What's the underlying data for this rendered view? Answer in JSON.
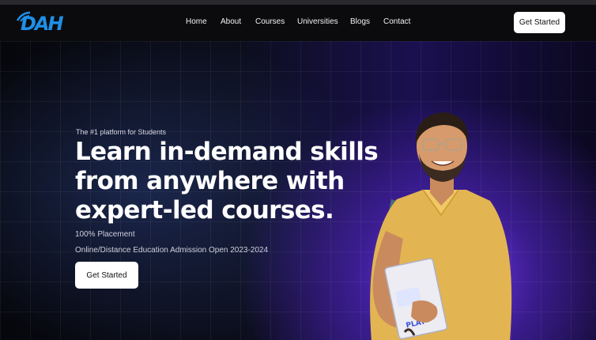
{
  "brand": {
    "logo_text": "DAH",
    "logo_color": "#1f8fe8"
  },
  "nav": {
    "items": [
      {
        "label": "Home"
      },
      {
        "label": "About"
      },
      {
        "label": "Courses"
      },
      {
        "label": "Universities"
      },
      {
        "label": "Blogs"
      },
      {
        "label": "Contact"
      }
    ],
    "cta_label": "Get Started"
  },
  "hero": {
    "tagline": "The #1 platform for Students",
    "headline_lines": [
      "Learn in-demand skills",
      "from anywhere with",
      "expert-led courses."
    ],
    "placement": "100% Placement",
    "admission": "Online/Distance Education Admission Open 2023-2024",
    "cta_label": "Get Started",
    "book_label": "PLAY",
    "accent_color": "#7a3cff"
  }
}
